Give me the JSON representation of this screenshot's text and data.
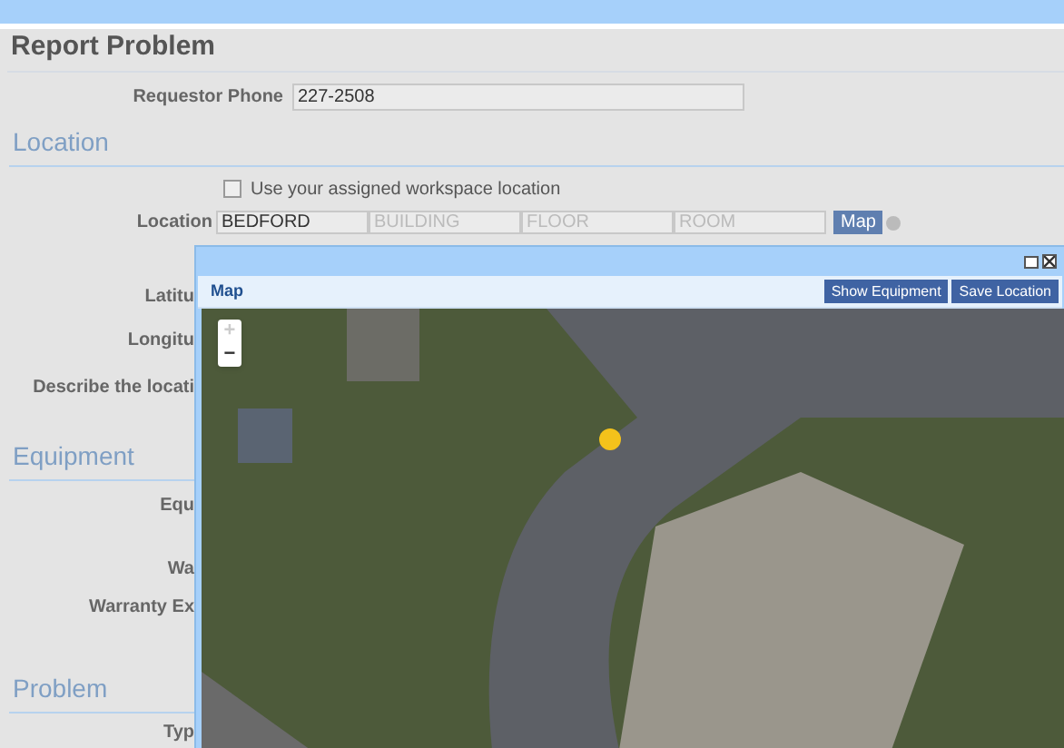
{
  "title": "Report Problem",
  "requestor_phone": {
    "label": "Requestor Phone",
    "value": "227-2508"
  },
  "location_section": {
    "heading": "Location",
    "workspace_checkbox": {
      "label": "Use your assigned workspace location",
      "checked": false
    },
    "location": {
      "label": "Location",
      "value": "BEDFORD",
      "placeholders": [
        "BUILDING",
        "FLOOR",
        "ROOM"
      ],
      "map_button": "Map"
    },
    "labels": [
      "Latitu",
      "Longitu",
      "Describe the locati"
    ]
  },
  "equipment_section": {
    "heading": "Equipment",
    "labels": [
      "Equ",
      "Wa",
      "Warranty Ex"
    ]
  },
  "problem_section": {
    "heading": "Problem",
    "labels": [
      "Typ"
    ]
  },
  "map_dialog": {
    "title": "Map",
    "buttons": [
      "Show Equipment",
      "Save Location"
    ],
    "zoom_in": {
      "label": "+",
      "disabled": true
    },
    "zoom_out": {
      "label": "−",
      "disabled": false
    }
  }
}
